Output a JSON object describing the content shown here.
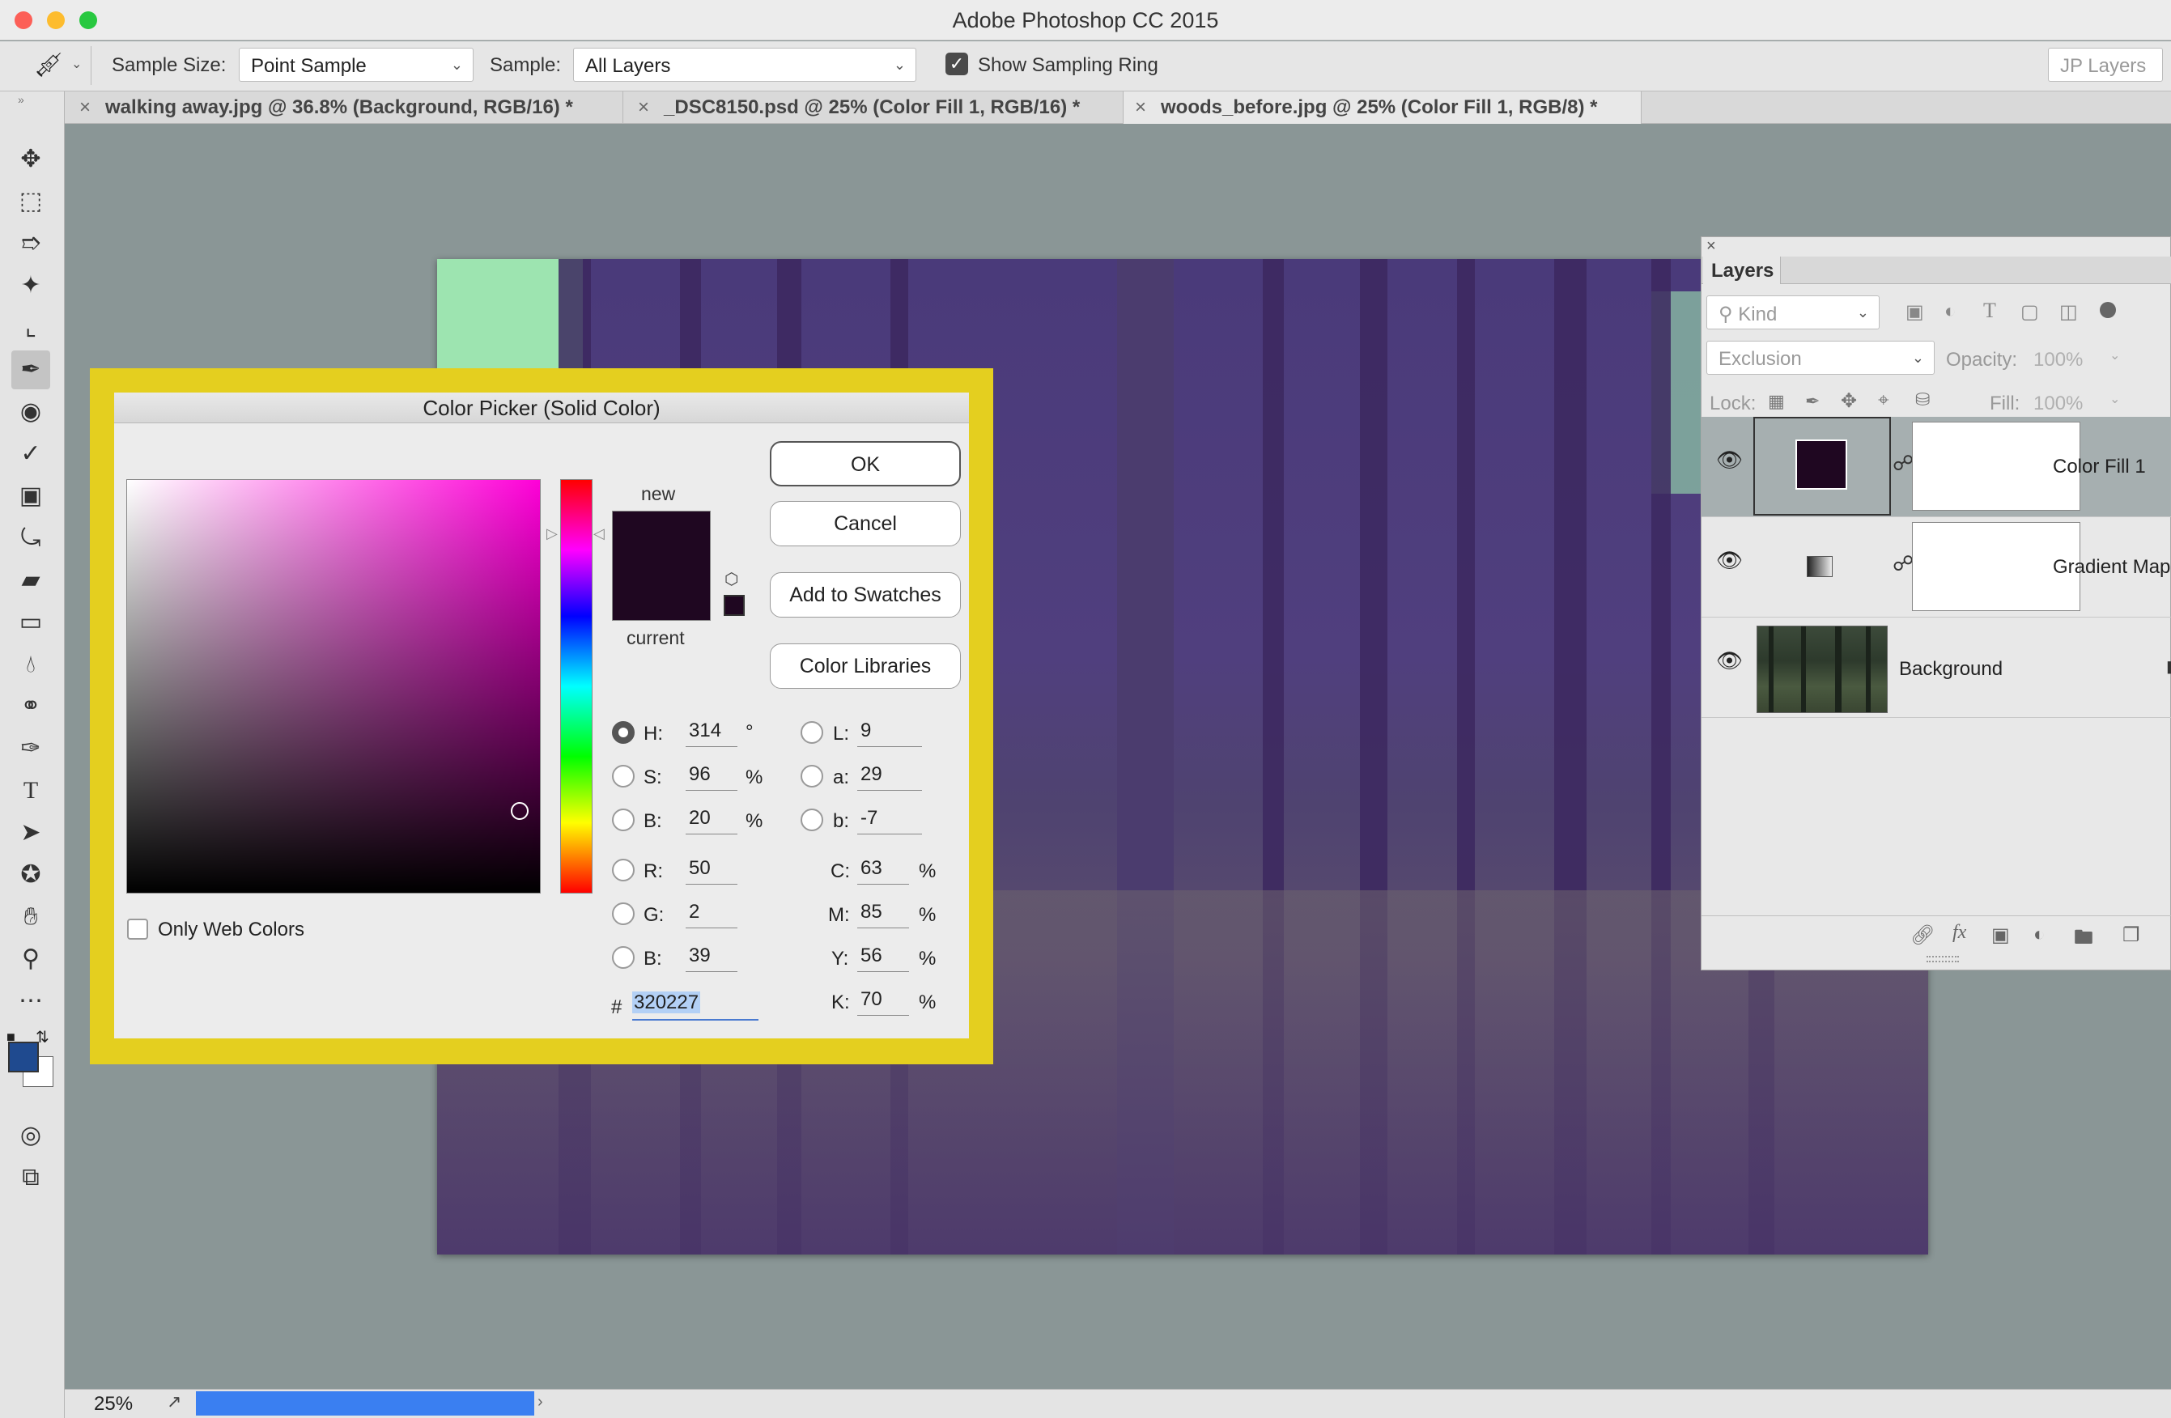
{
  "window": {
    "title": "Adobe Photoshop CC 2015"
  },
  "options_bar": {
    "sample_size_label": "Sample Size:",
    "sample_size_value": "Point Sample",
    "sample_label": "Sample:",
    "sample_value": "All Layers",
    "show_sampling_ring_label": "Show Sampling Ring",
    "workspace_label": "JP Layers"
  },
  "tabs": [
    {
      "label": "walking away.jpg @ 36.8% (Background, RGB/16) *"
    },
    {
      "label": "_DSC8150.psd @ 25% (Color Fill 1, RGB/16) *"
    },
    {
      "label": "woods_before.jpg @ 25% (Color Fill 1, RGB/8) *"
    }
  ],
  "status": {
    "zoom": "25%"
  },
  "color_picker": {
    "title": "Color Picker (Solid Color)",
    "new_label": "new",
    "current_label": "current",
    "new_color": "#1f0721",
    "ok_label": "OK",
    "cancel_label": "Cancel",
    "add_swatches_label": "Add to Swatches",
    "libraries_label": "Color Libraries",
    "only_web_label": "Only Web Colors",
    "fields": {
      "H": {
        "label": "H:",
        "value": "314",
        "unit": "°"
      },
      "S": {
        "label": "S:",
        "value": "96",
        "unit": "%"
      },
      "Bv": {
        "label": "B:",
        "value": "20",
        "unit": "%"
      },
      "R": {
        "label": "R:",
        "value": "50"
      },
      "G": {
        "label": "G:",
        "value": "2"
      },
      "Bc": {
        "label": "B:",
        "value": "39"
      },
      "L": {
        "label": "L:",
        "value": "9"
      },
      "a": {
        "label": "a:",
        "value": "29"
      },
      "b": {
        "label": "b:",
        "value": "-7"
      },
      "C": {
        "label": "C:",
        "value": "63",
        "unit": "%"
      },
      "M": {
        "label": "M:",
        "value": "85",
        "unit": "%"
      },
      "Y": {
        "label": "Y:",
        "value": "56",
        "unit": "%"
      },
      "K": {
        "label": "K:",
        "value": "70",
        "unit": "%"
      }
    },
    "hex_label": "#",
    "hex_value": "320227"
  },
  "layers_panel": {
    "title": "Layers",
    "filter_label": "Kind",
    "blend_mode": "Exclusion",
    "opacity_label": "Opacity:",
    "opacity_value": "100%",
    "lock_label": "Lock:",
    "fill_label": "Fill:",
    "fill_value": "100%",
    "layers": [
      {
        "name": "Color Fill 1"
      },
      {
        "name": "Gradient Map"
      },
      {
        "name": "Background"
      }
    ]
  }
}
